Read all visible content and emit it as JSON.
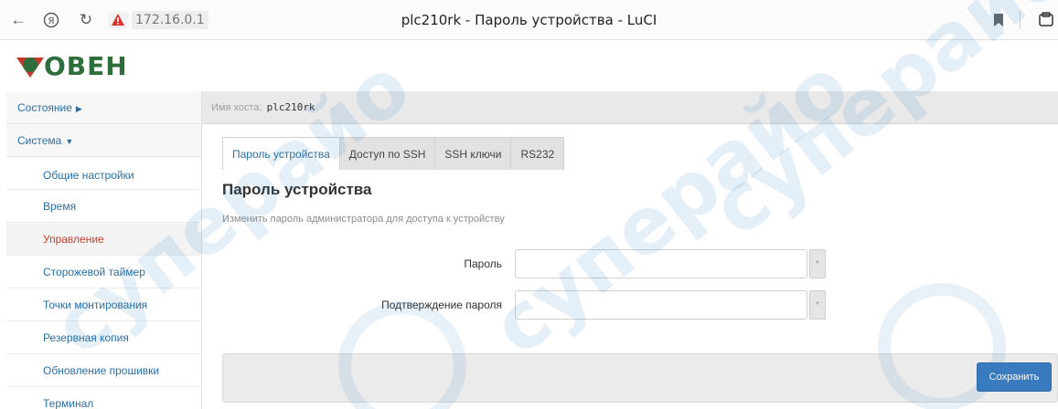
{
  "browser": {
    "back_icon": "←",
    "yandex_icon": "Я",
    "reload_icon": "↻",
    "warning_icon": "warning-triangle-icon",
    "url": "172.16.0.1",
    "page_title": "plc210rk - Пароль устройства - LuCI",
    "bookmark_icon": "bookmark-icon",
    "extension_icon": "tab-icon"
  },
  "logo": {
    "text": "ОВЕН",
    "color": "#2d6e3b"
  },
  "sidebar": {
    "sections": [
      {
        "label": "Состояние",
        "caret": "▶"
      },
      {
        "label": "Система",
        "caret": "▼"
      }
    ],
    "items": [
      {
        "label": "Общие настройки",
        "active": false
      },
      {
        "label": "Время",
        "active": false
      },
      {
        "label": "Управление",
        "active": true
      },
      {
        "label": "Сторожевой таймер",
        "active": false
      },
      {
        "label": "Точки монтирования",
        "active": false
      },
      {
        "label": "Резервная копия",
        "active": false
      },
      {
        "label": "Обновление прошивки",
        "active": false
      },
      {
        "label": "Терминал",
        "active": false
      }
    ]
  },
  "hostname": {
    "label": "Имя хоста:",
    "value": "plc210rk"
  },
  "tabs": [
    {
      "label": "Пароль устройства",
      "active": true
    },
    {
      "label": "Доступ по SSH",
      "active": false
    },
    {
      "label": "SSH ключи",
      "active": false
    },
    {
      "label": "RS232",
      "active": false
    }
  ],
  "section": {
    "title": "Пароль устройства",
    "description": "Изменить пароль администратора для доступа к устройству"
  },
  "form": {
    "password": {
      "label": "Пароль",
      "value": "",
      "placeholder": ""
    },
    "confirm": {
      "label": "Подтверждение пароля",
      "value": "",
      "placeholder": ""
    },
    "reveal_icon": "*"
  },
  "actions": {
    "save_label": "Сохранить"
  },
  "colors": {
    "link": "#2a6fa6",
    "active_item": "#c8422c",
    "save_button": "#3a7bbf"
  },
  "watermark": {
    "text": "суперайо"
  }
}
